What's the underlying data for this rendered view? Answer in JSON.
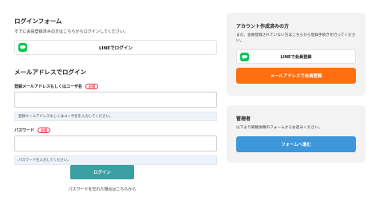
{
  "login": {
    "title": "ログインフォーム",
    "desc": "すでに会員登録済みの方はこちらからログインしてください。",
    "line_button": "LINEでログイン"
  },
  "email_login": {
    "title": "メールアドレスでログイン",
    "email_label": "登録メールアドレスもしくはユーザ名",
    "required": "必須",
    "email_hint": "登録メールアドレスもしくはユーザ名を入力してください。",
    "password_label": "パスワード",
    "password_hint": "パスワードを入力してください。",
    "submit": "ログイン",
    "forgot": "パスワードを忘れた場合はこちらから"
  },
  "register": {
    "title": "アカウント作成済みの方",
    "desc": "まだ、会員登録されていない方はこちらから登録手続きを行ってください。",
    "line_button": "LINEで会員登録",
    "email_button": "メールアドレスで会員登録"
  },
  "admin": {
    "title": "管理者",
    "desc": "以下より掲載依頼のフォームからお進みください。",
    "button": "フォームへ進む"
  },
  "colors": {
    "accent_teal": "#3aa0a3",
    "orange": "#ff6e10",
    "blue": "#3d97d8",
    "line_green": "#06c755"
  }
}
